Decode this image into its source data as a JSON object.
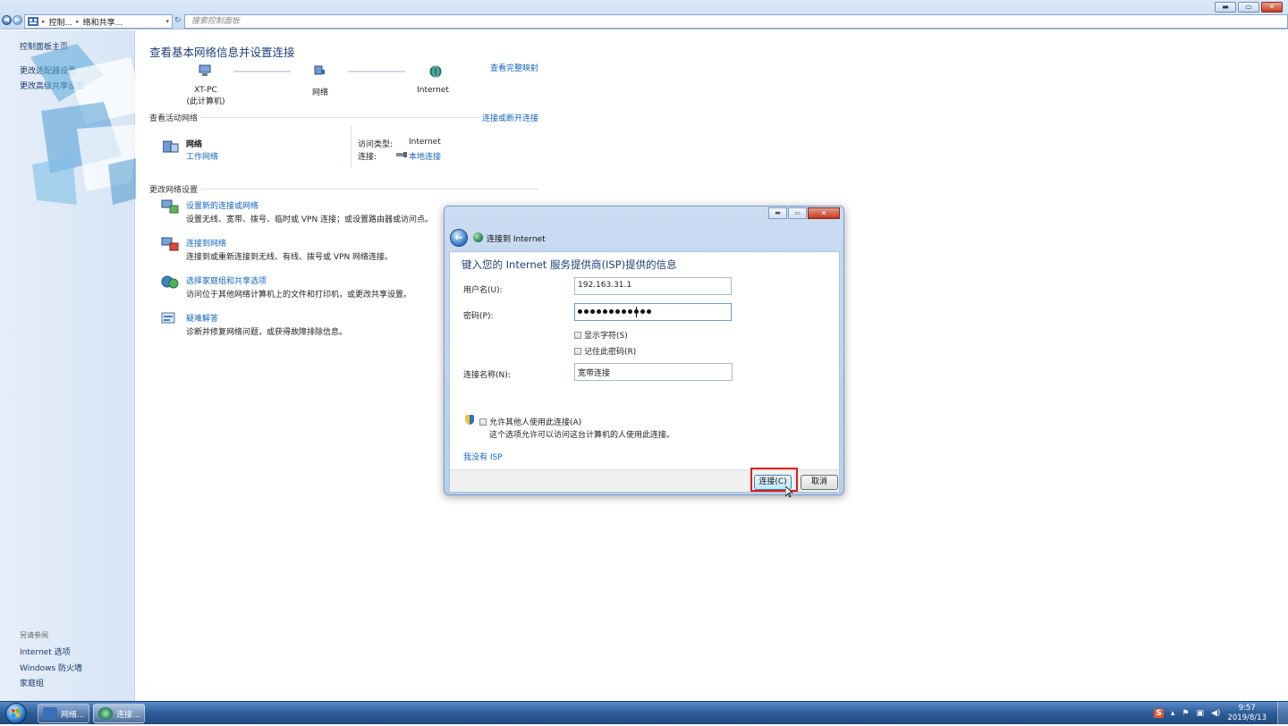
{
  "explorer": {
    "breadcrumb": [
      "控制...",
      "络和共享..."
    ],
    "search_placeholder": "搜索控制面板",
    "window_buttons": {
      "minimize": "▬",
      "maximize": "▭",
      "close": "✕"
    },
    "help_icon": "?"
  },
  "sidebar": {
    "links": [
      "控制面板主页",
      "更改适配器设置",
      "更改高级共享设置"
    ],
    "see_also_heading": "另请参阅",
    "see_also": [
      "Internet 选项",
      "Windows 防火墙",
      "家庭组"
    ]
  },
  "main": {
    "title": "查看基本网络信息并设置连接",
    "view_full_map": "查看完整映射",
    "map_nodes": [
      {
        "name": "XT-PC",
        "sub": "(此计算机)"
      },
      {
        "name": "网络",
        "sub": ""
      },
      {
        "name": "Internet",
        "sub": ""
      }
    ],
    "active_heading": "查看活动网络",
    "connect_disconnect": "连接或断开连接",
    "network": {
      "name": "网络",
      "type": "工作网络",
      "access_label": "访问类型:",
      "access_value": "Internet",
      "connection_label": "连接:",
      "connection_value": "本地连接"
    },
    "change_heading": "更改网络设置",
    "tasks": [
      {
        "title": "设置新的连接或网络",
        "desc": "设置无线、宽带、拨号、临时或 VPN 连接；或设置路由器或访问点。"
      },
      {
        "title": "连接到网络",
        "desc": "连接到或重新连接到无线、有线、拨号或 VPN 网络连接。"
      },
      {
        "title": "选择家庭组和共享选项",
        "desc": "访问位于其他网络计算机上的文件和打印机，或更改共享设置。"
      },
      {
        "title": "疑难解答",
        "desc": "诊断并修复网络问题，或获得故障排除信息。"
      }
    ]
  },
  "dialog": {
    "title": "连接到 Internet",
    "heading": "键入您的 Internet 服务提供商(ISP)提供的信息",
    "username_label": "用户名(U):",
    "username_value": "192.163.31.1",
    "password_label": "密码(P):",
    "password_length": 12,
    "show_chars": "显示字符(S)",
    "remember_pw": "记住此密码(R)",
    "conn_name_label": "连接名称(N):",
    "conn_name_value": "宽带连接",
    "allow_others": "允许其他人使用此连接(A)",
    "allow_desc": "这个选项允许可以访问这台计算机的人使用此连接。",
    "no_isp": "我没有 ISP",
    "connect_btn": "连接(C)",
    "cancel_btn": "取消",
    "window_buttons": {
      "minimize": "▬",
      "maximize": "▭",
      "close": "✕"
    }
  },
  "taskbar": {
    "buttons": [
      "网络...",
      "连接..."
    ],
    "ime": "S",
    "time": "9:57",
    "date": "2019/8/13"
  },
  "colors": {
    "link": "#1565c0",
    "title": "#1e3f78",
    "highlight": "#e31a1a"
  }
}
